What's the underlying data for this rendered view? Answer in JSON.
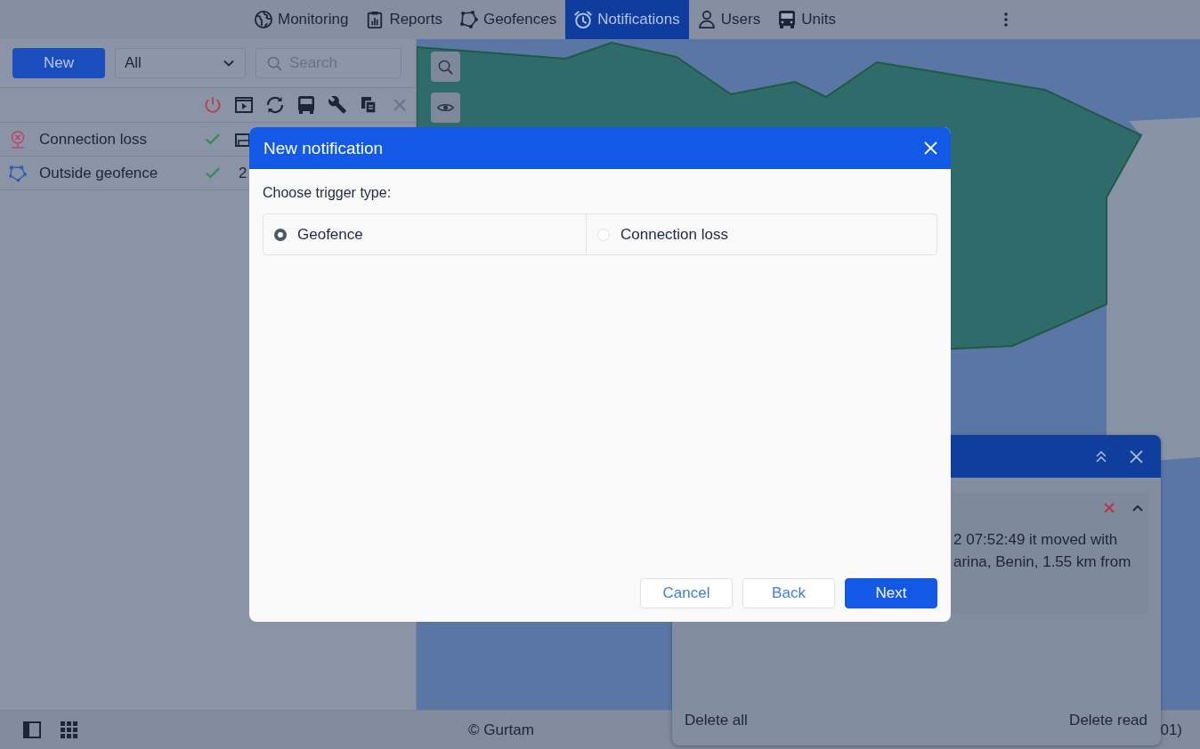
{
  "top_nav": {
    "tabs": [
      {
        "label": "Monitoring",
        "selected": false
      },
      {
        "label": "Reports",
        "selected": false
      },
      {
        "label": "Geofences",
        "selected": false
      },
      {
        "label": "Notifications",
        "selected": true
      },
      {
        "label": "Users",
        "selected": false
      },
      {
        "label": "Units",
        "selected": false
      }
    ]
  },
  "left_panel": {
    "new_button": "New",
    "filter": {
      "value": "All"
    },
    "search": {
      "placeholder": "Search"
    },
    "notifications": [
      {
        "name": "Connection loss",
        "kind": "connection_loss",
        "active": true
      },
      {
        "name": "Outside geofence",
        "kind": "geofence",
        "active": true,
        "column_3": "2"
      }
    ]
  },
  "notification_popup": {
    "message_lines": [
      "2 07:52:49 it moved with",
      "arina, Benin, 1.55 km from"
    ],
    "actions": [
      "Delete all",
      "Delete read"
    ]
  },
  "dialog": {
    "title": "New notification",
    "prompt": "Choose trigger type:",
    "trigger_types": [
      {
        "label": "Geofence",
        "selected": true
      },
      {
        "label": "Connection loss",
        "selected": false
      }
    ],
    "buttons": [
      {
        "label": "Cancel",
        "kind": "secondary"
      },
      {
        "label": "Back",
        "kind": "secondary"
      },
      {
        "label": "Next",
        "kind": "primary"
      }
    ]
  },
  "status_bar": {
    "copyright": "© Gurtam",
    "column_2": "01)"
  }
}
